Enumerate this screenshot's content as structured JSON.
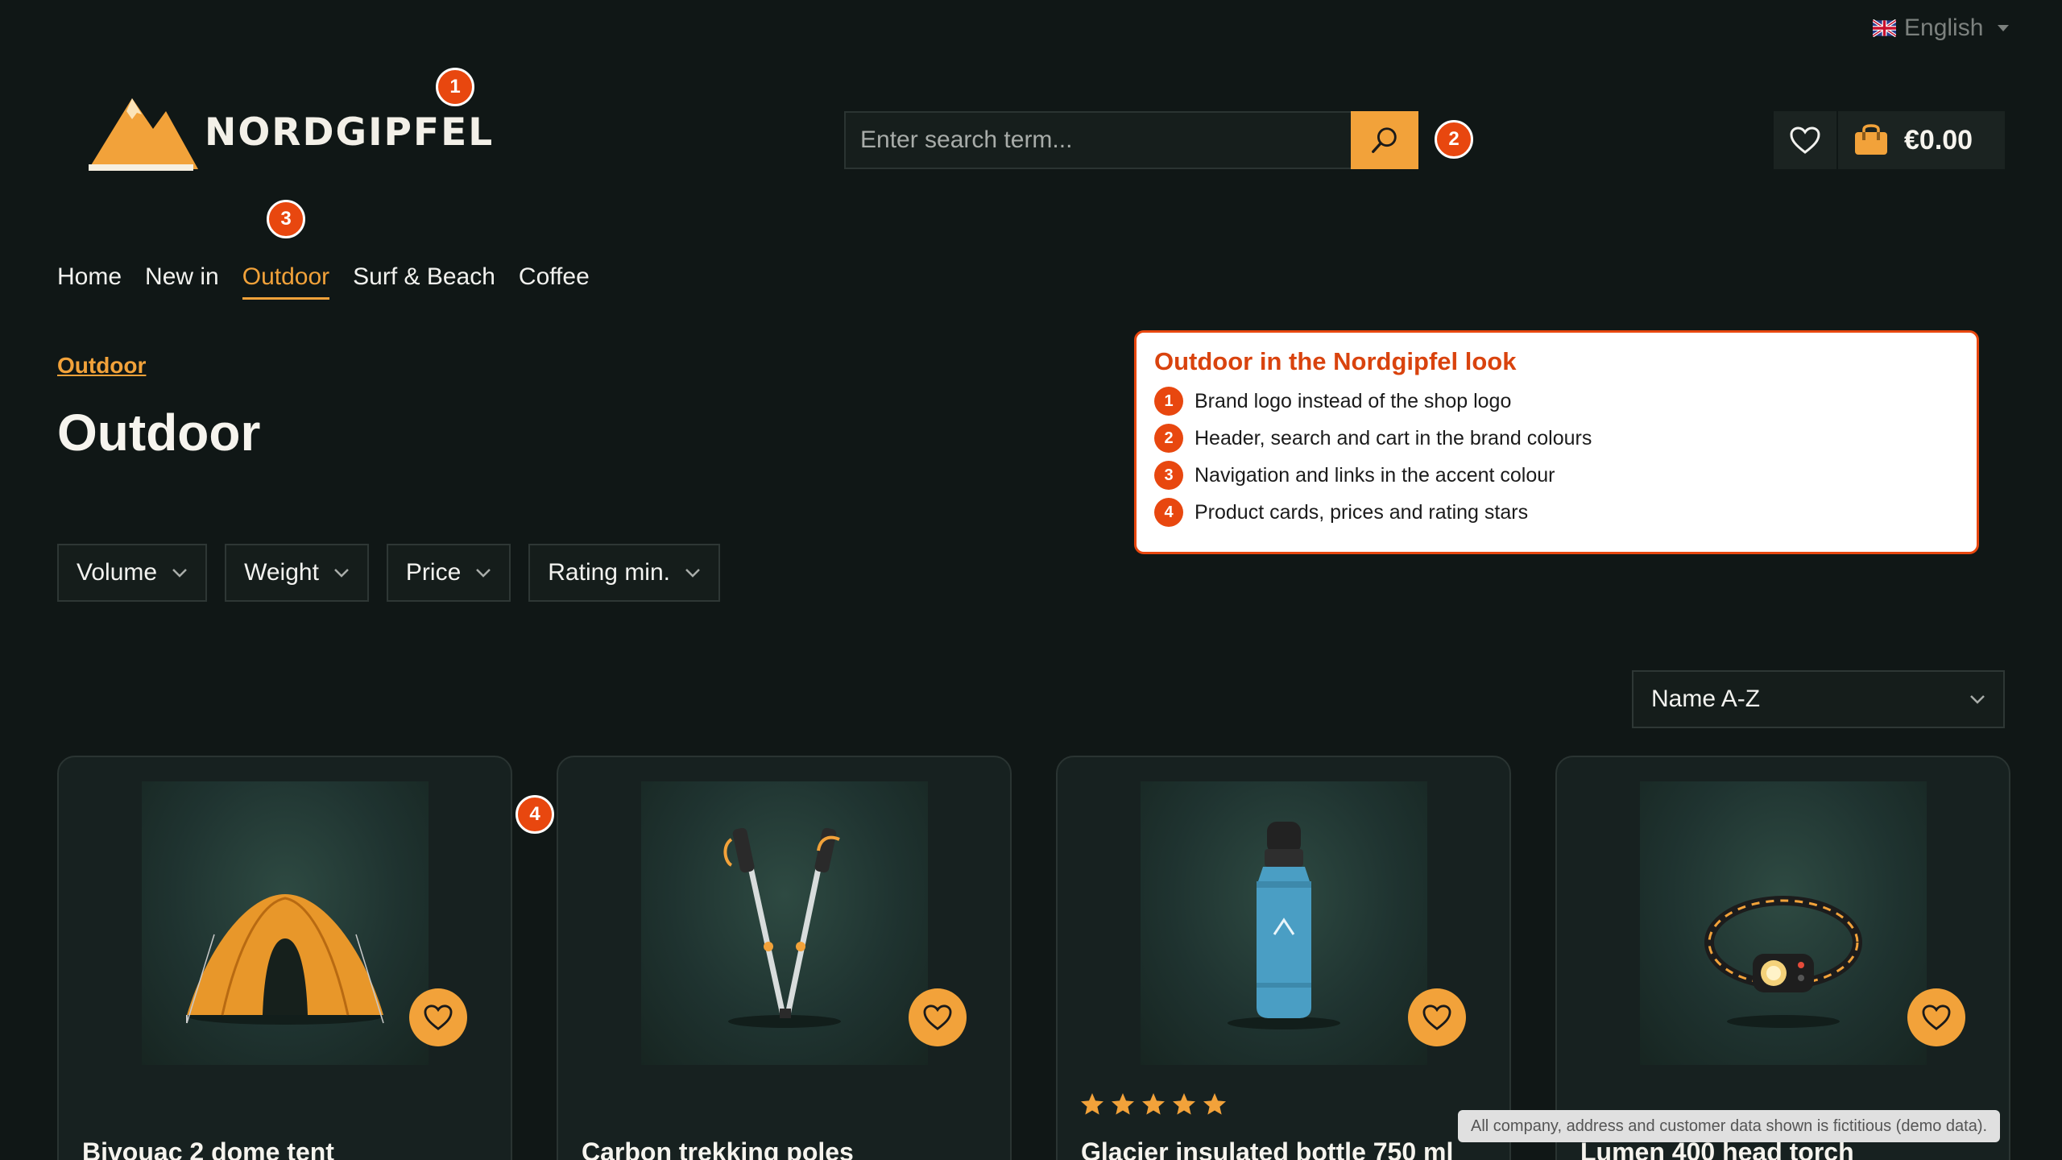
{
  "header": {
    "language": "English",
    "brand": "NORDGIPFEL",
    "search_placeholder": "Enter search term...",
    "cart_total": "€0.00"
  },
  "markers": [
    "1",
    "2",
    "3",
    "4"
  ],
  "nav": {
    "items": [
      {
        "label": "Home"
      },
      {
        "label": "New in"
      },
      {
        "label": "Outdoor"
      },
      {
        "label": "Surf & Beach"
      },
      {
        "label": "Coffee"
      }
    ],
    "active": "Outdoor"
  },
  "breadcrumb": "Outdoor",
  "page_title": "Outdoor",
  "note": {
    "title": "Outdoor in the Nordgipfel look",
    "items": [
      {
        "num": "1",
        "text": "Brand logo instead of the shop logo"
      },
      {
        "num": "2",
        "text": "Header, search and cart in the brand colours"
      },
      {
        "num": "3",
        "text": "Navigation and links in the accent colour"
      },
      {
        "num": "4",
        "text": "Product cards, prices and rating stars"
      }
    ]
  },
  "filters": [
    {
      "label": "Volume"
    },
    {
      "label": "Weight"
    },
    {
      "label": "Price"
    },
    {
      "label": "Rating min."
    }
  ],
  "sort": {
    "selected": "Name A-Z"
  },
  "products": [
    {
      "name": "Bivouac 2 dome tent",
      "icon": "tent-icon",
      "rating": null
    },
    {
      "name": "Carbon trekking poles",
      "icon": "trekking-poles-icon",
      "rating": null
    },
    {
      "name": "Glacier insulated bottle 750 ml",
      "icon": "bottle-icon",
      "rating": 5
    },
    {
      "name": "Lumen 400 head torch",
      "icon": "head-torch-icon",
      "rating": null
    }
  ],
  "demo_notice": "All company, address and customer data shown is fictitious (demo data).",
  "colors": {
    "background": "#101716",
    "accent": "#f2a23a",
    "marker": "#e8470f",
    "card": "#172120"
  }
}
